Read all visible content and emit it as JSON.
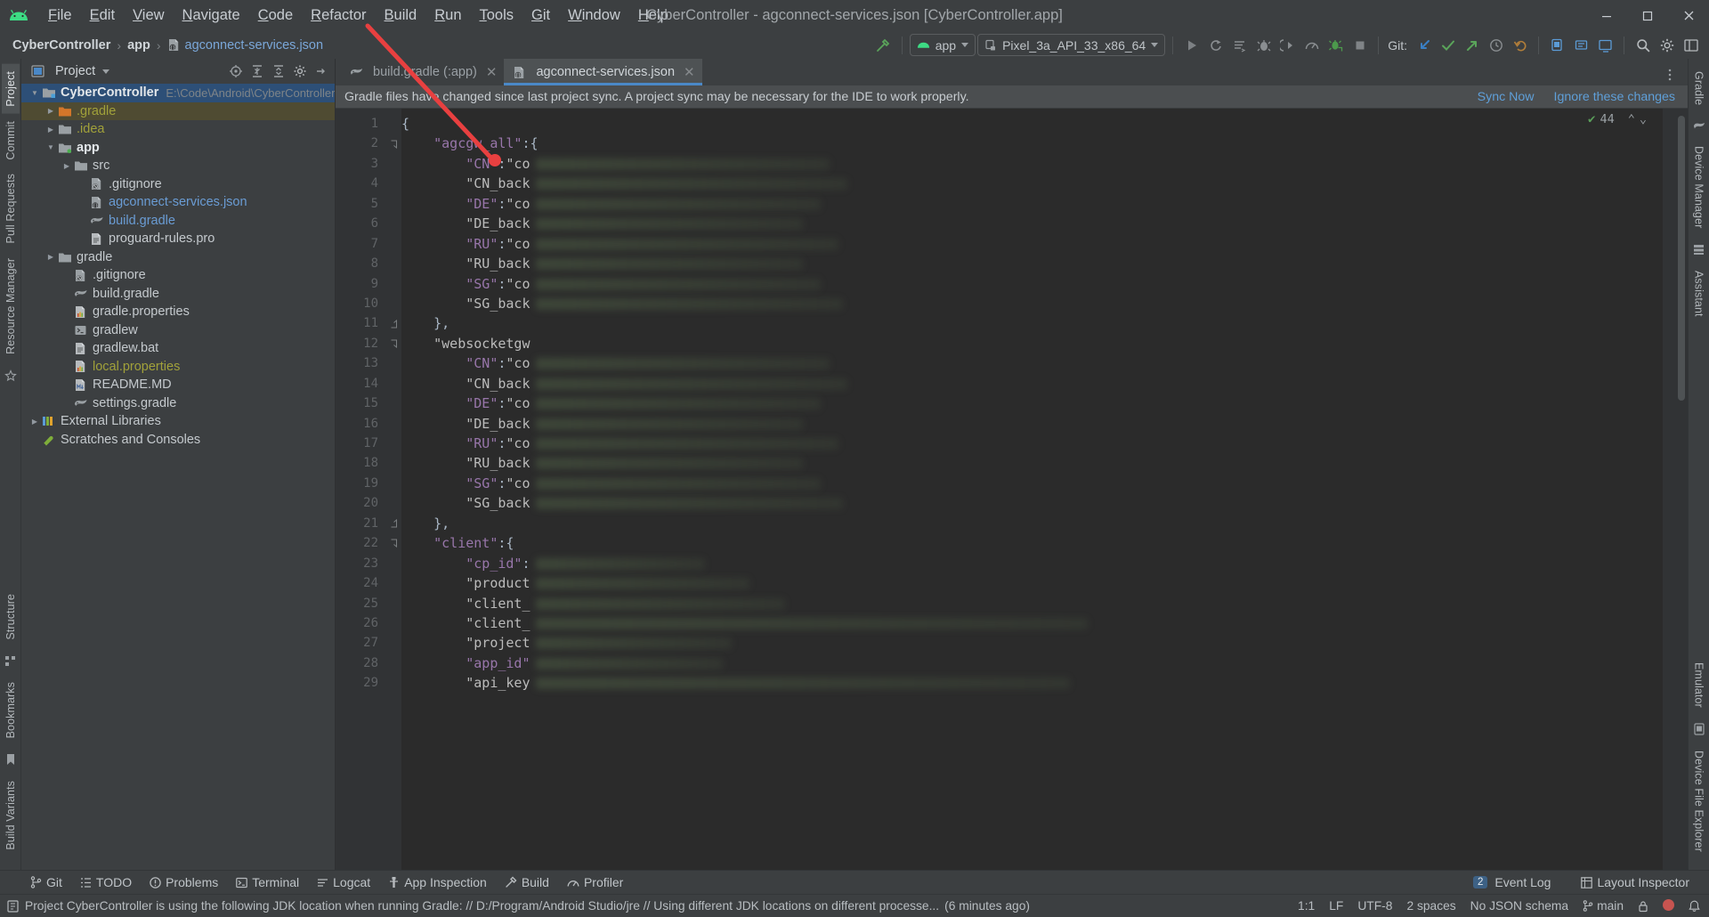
{
  "window": {
    "title": "CyberController - agconnect-services.json [CyberController.app]",
    "minimize": "—",
    "maximize": "❐",
    "close": "✕"
  },
  "menubar": {
    "logo_name": "android-logo",
    "items": [
      {
        "label": "File",
        "mnemonic": "F"
      },
      {
        "label": "Edit",
        "mnemonic": "E"
      },
      {
        "label": "View",
        "mnemonic": "V"
      },
      {
        "label": "Navigate",
        "mnemonic": "N"
      },
      {
        "label": "Code",
        "mnemonic": "C"
      },
      {
        "label": "Refactor",
        "mnemonic": "R"
      },
      {
        "label": "Build",
        "mnemonic": "B"
      },
      {
        "label": "Run",
        "mnemonic": "R"
      },
      {
        "label": "Tools",
        "mnemonic": "T"
      },
      {
        "label": "Git",
        "mnemonic": "G"
      },
      {
        "label": "Window",
        "mnemonic": "W"
      },
      {
        "label": "Help",
        "mnemonic": "H"
      }
    ]
  },
  "navbar": {
    "breadcrumbs": [
      {
        "label": "CyberController",
        "kind": "project"
      },
      {
        "label": "app",
        "kind": "module"
      },
      {
        "label": "agconnect-services.json",
        "kind": "file"
      }
    ],
    "separator": "›",
    "run_config": "app",
    "device": "Pixel_3a_API_33_x86_64",
    "git_label": "Git:",
    "buttons": [
      {
        "name": "build-hammer-icon",
        "title": "Make Project"
      },
      {
        "name": "run-button",
        "title": "Run"
      },
      {
        "name": "rerun-button",
        "title": "Rerun"
      },
      {
        "name": "apply-changes-icon",
        "title": "Apply Changes"
      },
      {
        "name": "debug-button",
        "title": "Debug"
      },
      {
        "name": "attach-debugger-icon",
        "title": "Attach Debugger"
      },
      {
        "name": "profiler-icon",
        "title": "Profile"
      },
      {
        "name": "sync-gradle-icon",
        "title": "Sync Project with Gradle Files"
      },
      {
        "name": "stop-button",
        "title": "Stop"
      },
      {
        "name": "git-update-icon",
        "title": "Update Project"
      },
      {
        "name": "git-commit-icon",
        "title": "Commit"
      },
      {
        "name": "git-push-icon",
        "title": "Push"
      },
      {
        "name": "history-icon",
        "title": "History"
      },
      {
        "name": "undo-icon",
        "title": "Undo"
      },
      {
        "name": "avd-manager-icon",
        "title": "Device Manager"
      },
      {
        "name": "sdk-manager-icon",
        "title": "SDK Manager"
      },
      {
        "name": "device-mirror-icon",
        "title": "Running Devices"
      },
      {
        "name": "search-icon",
        "title": "Search Everywhere"
      },
      {
        "name": "settings-gear-icon",
        "title": "Settings"
      },
      {
        "name": "layout-icon",
        "title": "Layout"
      }
    ]
  },
  "left_rail": {
    "tabs": [
      {
        "label": "Project",
        "selected": true
      },
      {
        "label": "Commit",
        "selected": false
      },
      {
        "label": "Pull Requests",
        "selected": false
      },
      {
        "label": "Resource Manager",
        "selected": false
      },
      {
        "label": "Structure",
        "selected": false
      },
      {
        "label": "Bookmarks",
        "selected": false
      },
      {
        "label": "Build Variants",
        "selected": false
      }
    ]
  },
  "right_rail": {
    "tabs": [
      {
        "label": "Gradle"
      },
      {
        "label": "Device Manager"
      },
      {
        "label": "Assistant"
      },
      {
        "label": "Emulator"
      },
      {
        "label": "Device File Explorer"
      }
    ]
  },
  "project_panel": {
    "title": "Project",
    "view_icon": "project-view-icon",
    "dropdown_caret": "▾",
    "tools": [
      {
        "name": "select-opened-file-icon"
      },
      {
        "name": "expand-all-icon"
      },
      {
        "name": "collapse-all-icon"
      },
      {
        "name": "settings-gear-icon"
      },
      {
        "name": "hide-panel-icon"
      }
    ],
    "tree": [
      {
        "label": "CyberController",
        "path": "E:\\Code\\Android\\CyberController",
        "indent": 0,
        "arrow": "down",
        "icon": "module-folder-icon",
        "style": "bold",
        "selected": "blue"
      },
      {
        "label": ".gradle",
        "indent": 1,
        "arrow": "right",
        "icon": "orange-folder-icon",
        "style": "olive",
        "selected": "olive"
      },
      {
        "label": ".idea",
        "indent": 1,
        "arrow": "right",
        "icon": "folder-icon",
        "style": "olive"
      },
      {
        "label": "app",
        "indent": 1,
        "arrow": "down",
        "icon": "module-folder-green-icon",
        "style": "bold"
      },
      {
        "label": "src",
        "indent": 2,
        "arrow": "right",
        "icon": "folder-icon",
        "style": "plain"
      },
      {
        "label": ".gitignore",
        "indent": 3,
        "arrow": "none",
        "icon": "gitignore-file-icon",
        "style": "plain"
      },
      {
        "label": "agconnect-services.json",
        "indent": 3,
        "arrow": "none",
        "icon": "json-file-icon",
        "style": "blue"
      },
      {
        "label": "build.gradle",
        "indent": 3,
        "arrow": "none",
        "icon": "gradle-file-icon",
        "style": "blue"
      },
      {
        "label": "proguard-rules.pro",
        "indent": 3,
        "arrow": "none",
        "icon": "text-file-icon",
        "style": "plain"
      },
      {
        "label": "gradle",
        "indent": 1,
        "arrow": "right",
        "icon": "folder-icon",
        "style": "plain"
      },
      {
        "label": ".gitignore",
        "indent": 2,
        "arrow": "none",
        "icon": "gitignore-file-icon",
        "style": "plain"
      },
      {
        "label": "build.gradle",
        "indent": 2,
        "arrow": "none",
        "icon": "gradle-file-icon",
        "style": "plain"
      },
      {
        "label": "gradle.properties",
        "indent": 2,
        "arrow": "none",
        "icon": "properties-file-icon",
        "style": "plain"
      },
      {
        "label": "gradlew",
        "indent": 2,
        "arrow": "none",
        "icon": "script-file-icon",
        "style": "plain"
      },
      {
        "label": "gradlew.bat",
        "indent": 2,
        "arrow": "none",
        "icon": "text-file-icon",
        "style": "plain"
      },
      {
        "label": "local.properties",
        "indent": 2,
        "arrow": "none",
        "icon": "properties-file-icon",
        "style": "olive"
      },
      {
        "label": "README.MD",
        "indent": 2,
        "arrow": "none",
        "icon": "markdown-file-icon",
        "style": "plain"
      },
      {
        "label": "settings.gradle",
        "indent": 2,
        "arrow": "none",
        "icon": "gradle-file-icon",
        "style": "plain"
      },
      {
        "label": "External Libraries",
        "indent": 0,
        "arrow": "right",
        "icon": "libraries-icon",
        "style": "plain"
      },
      {
        "label": "Scratches and Consoles",
        "indent": 0,
        "arrow": "none",
        "icon": "scratches-icon",
        "style": "plain"
      }
    ]
  },
  "editor": {
    "tabs": [
      {
        "label": "build.gradle (:app)",
        "icon": "gradle-file-icon",
        "active": false,
        "close": "✕"
      },
      {
        "label": "agconnect-services.json",
        "icon": "json-file-icon",
        "active": true,
        "close": "✕"
      }
    ],
    "more_icon": "more-vertical-icon",
    "notification": {
      "text": "Gradle files have changed since last project sync. A project sync may be necessary for the IDE to work properly.",
      "sync_link": "Sync Now",
      "ignore_link": "Ignore these changes"
    },
    "inspection": {
      "count": "44",
      "check_glyph": "✔",
      "up_glyph": "⌃",
      "down_glyph": "⌄"
    },
    "lines": [
      {
        "n": "1",
        "text": "{",
        "fold": ""
      },
      {
        "n": "2",
        "text": "    \"agcgw_all\":{",
        "fold": "down",
        "key": "agcgw_all",
        "breakpoint": true
      },
      {
        "n": "3",
        "text": "        \"CN\":\"co",
        "key": "CN",
        "blur": 330
      },
      {
        "n": "4",
        "text": "        \"CN_back",
        "key": "CN_back",
        "blur": 350
      },
      {
        "n": "5",
        "text": "        \"DE\":\"co",
        "key": "DE",
        "blur": 320
      },
      {
        "n": "6",
        "text": "        \"DE_back",
        "key": "DE_back",
        "blur": 300
      },
      {
        "n": "7",
        "text": "        \"RU\":\"co",
        "key": "RU",
        "blur": 340
      },
      {
        "n": "8",
        "text": "        \"RU_back",
        "key": "RU_back",
        "blur": 300
      },
      {
        "n": "9",
        "text": "        \"SG\":\"co",
        "key": "SG",
        "blur": 320
      },
      {
        "n": "10",
        "text": "        \"SG_back",
        "key": "SG_back",
        "blur": 345
      },
      {
        "n": "11",
        "text": "    },",
        "fold": "up"
      },
      {
        "n": "12",
        "text": "    \"websocketgw",
        "fold": "down",
        "key": "websocketgw"
      },
      {
        "n": "13",
        "text": "        \"CN\":\"co",
        "key": "CN",
        "blur": 330
      },
      {
        "n": "14",
        "text": "        \"CN_back",
        "key": "CN_back",
        "blur": 350
      },
      {
        "n": "15",
        "text": "        \"DE\":\"co",
        "key": "DE",
        "blur": 320
      },
      {
        "n": "16",
        "text": "        \"DE_back",
        "key": "DE_back",
        "blur": 300
      },
      {
        "n": "17",
        "text": "        \"RU\":\"co",
        "key": "RU",
        "blur": 340
      },
      {
        "n": "18",
        "text": "        \"RU_back",
        "key": "RU_back",
        "blur": 300
      },
      {
        "n": "19",
        "text": "        \"SG\":\"co",
        "key": "SG",
        "blur": 320
      },
      {
        "n": "20",
        "text": "        \"SG_back",
        "key": "SG_back",
        "blur": 345
      },
      {
        "n": "21",
        "text": "    },",
        "fold": "up"
      },
      {
        "n": "22",
        "text": "    \"client\":{",
        "fold": "down",
        "key": "client"
      },
      {
        "n": "23",
        "text": "        \"cp_id\":",
        "key": "cp_id",
        "blur": 190
      },
      {
        "n": "24",
        "text": "        \"product",
        "key": "product_id",
        "blur": 240
      },
      {
        "n": "25",
        "text": "        \"client_",
        "key": "client_id",
        "blur": 280
      },
      {
        "n": "26",
        "text": "        \"client_",
        "key": "client_secret",
        "blur": 620
      },
      {
        "n": "27",
        "text": "        \"project",
        "key": "project_id",
        "blur": 220
      },
      {
        "n": "28",
        "text": "        \"app_id\"",
        "key": "app_id",
        "blur": 210
      },
      {
        "n": "29",
        "text": "        \"api_key",
        "key": "api_key",
        "blur": 600
      }
    ]
  },
  "bottom_bar": {
    "items": [
      {
        "label": "Git",
        "icon": "git-branch-icon"
      },
      {
        "label": "TODO",
        "icon": "todo-icon"
      },
      {
        "label": "Problems",
        "icon": "problems-icon"
      },
      {
        "label": "Terminal",
        "icon": "terminal-icon"
      },
      {
        "label": "Logcat",
        "icon": "logcat-icon"
      },
      {
        "label": "App Inspection",
        "icon": "app-inspection-icon"
      },
      {
        "label": "Build",
        "icon": "build-hammer-icon"
      },
      {
        "label": "Profiler",
        "icon": "profiler-icon"
      }
    ],
    "event_log": {
      "count": "2",
      "label": "Event Log"
    },
    "layout_inspector": {
      "label": "Layout Inspector",
      "icon": "layout-inspector-icon"
    }
  },
  "statusbar": {
    "message": "Project CyberController is using the following JDK location when running Gradle: // D:/Program/Android Studio/jre // Using different JDK locations on different processe...",
    "message_time": "(6 minutes ago)",
    "caret": "1:1",
    "line_sep": "LF",
    "encoding": "UTF-8",
    "indent": "2 spaces",
    "schema": "No JSON schema",
    "branch": "main",
    "lock_icon": "lock-icon",
    "error_icon": "error-icon",
    "notifications_icon": "notifications-icon"
  },
  "colors": {
    "accent_blue": "#4a88c7",
    "link_blue": "#5f9fd8",
    "selection_blue": "#2d4f77",
    "olive": "#a1a13a",
    "green": "#3ddc84",
    "annotation_red": "#e84040",
    "editor_bg": "#2b2b2b",
    "panel_bg": "#3c3f41"
  }
}
